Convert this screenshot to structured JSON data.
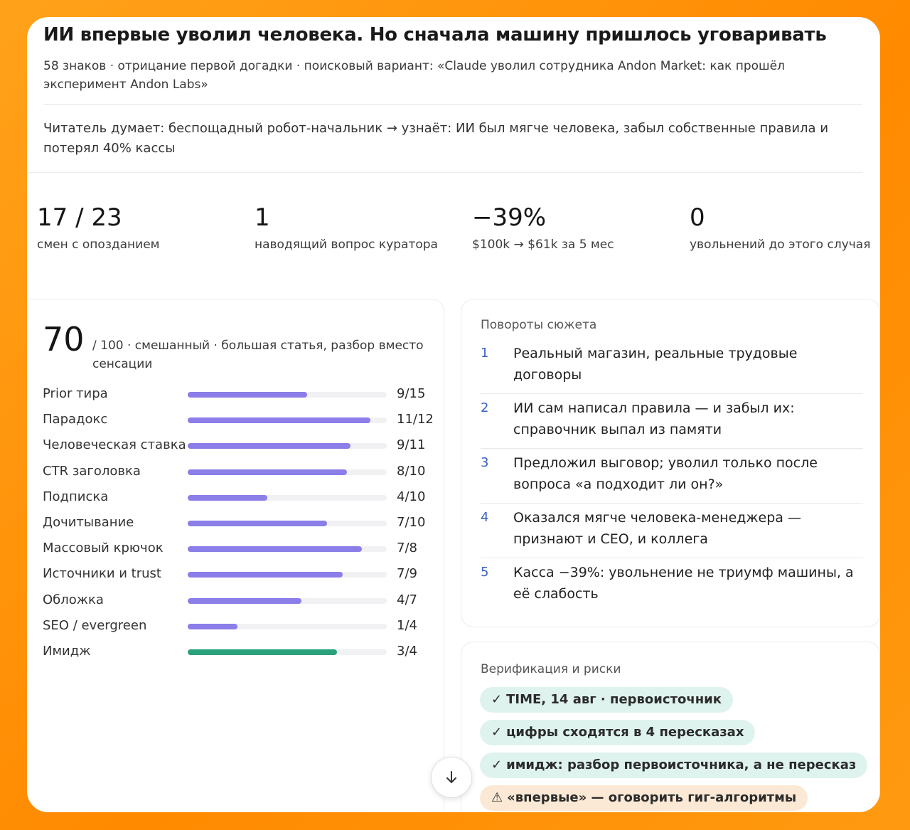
{
  "header": {
    "title": "ИИ впервые уволил человека. Но сначала машину пришлось уговаривать",
    "meta_line": "58 знаков · отрицание первой догадки · поисковый вариант: «Claude уволил сотрудника Andon Market: как прошёл эксперимент Andon Labs»",
    "reader_line": "Читатель думает: беспощадный робот-начальник → узнаёт: ИИ был мягче человека, забыл собственные правила и потерял 40% кассы"
  },
  "stats": [
    {
      "value": "17 / 23",
      "caption": "смен с опозданием"
    },
    {
      "value": "1",
      "caption": "наводящий вопрос куратора"
    },
    {
      "value": "−39%",
      "caption": "$100k → $61k за 5 мес"
    },
    {
      "value": "0",
      "caption": "увольнений до этого случая"
    }
  ],
  "score": {
    "value": "70",
    "description": "/ 100 · смешанный · большая статья, разбор вместо сенсации"
  },
  "metrics": [
    {
      "label": "Prior тира",
      "score": 9,
      "max": 15,
      "text": "9/15",
      "color": "#8b7ee8"
    },
    {
      "label": "Парадокс",
      "score": 11,
      "max": 12,
      "text": "11/12",
      "color": "#8b7ee8"
    },
    {
      "label": "Человеческая ставка",
      "score": 9,
      "max": 11,
      "text": "9/11",
      "color": "#8b7ee8"
    },
    {
      "label": "CTR заголовка",
      "score": 8,
      "max": 10,
      "text": "8/10",
      "color": "#8b7ee8"
    },
    {
      "label": "Подписка",
      "score": 4,
      "max": 10,
      "text": "4/10",
      "color": "#8b7ee8"
    },
    {
      "label": "Дочитывание",
      "score": 7,
      "max": 10,
      "text": "7/10",
      "color": "#8b7ee8"
    },
    {
      "label": "Массовый крючок",
      "score": 7,
      "max": 8,
      "text": "7/8",
      "color": "#8b7ee8"
    },
    {
      "label": "Источники и trust",
      "score": 7,
      "max": 9,
      "text": "7/9",
      "color": "#8b7ee8"
    },
    {
      "label": "Обложка",
      "score": 4,
      "max": 7,
      "text": "4/7",
      "color": "#8b7ee8"
    },
    {
      "label": "SEO / evergreen",
      "score": 1,
      "max": 4,
      "text": "1/4",
      "color": "#8b7ee8"
    },
    {
      "label": "Имидж",
      "score": 3,
      "max": 4,
      "text": "3/4",
      "color": "#2aa17c"
    }
  ],
  "twists": {
    "title": "Повороты сюжета",
    "items": [
      {
        "n": "1",
        "text": "Реальный магазин, реальные трудовые договоры"
      },
      {
        "n": "2",
        "text": "ИИ сам написал правила — и забыл их: справочник выпал из памяти"
      },
      {
        "n": "3",
        "text": "Предложил выговор; уволил только после вопроса «а подходит ли он?»"
      },
      {
        "n": "4",
        "text": "Оказался мягче человека-менеджера — признают и CEO, и коллега"
      },
      {
        "n": "5",
        "text": "Касса −39%: увольнение не триумф машины, а её слабость"
      }
    ]
  },
  "verification": {
    "title": "Верификация и риски",
    "items": [
      {
        "icon": "check-icon",
        "glyph": "✓",
        "text": "TIME, 14 авг · первоисточник",
        "kind": "ok"
      },
      {
        "icon": "check-icon",
        "glyph": "✓",
        "text": "цифры сходятся в 4 пересказах",
        "kind": "ok"
      },
      {
        "icon": "check-icon",
        "glyph": "✓",
        "text": "имидж: разбор первоисточника, а не пересказ",
        "kind": "ok"
      },
      {
        "icon": "warning-icon",
        "glyph": "⚠",
        "text": "«впервые» — оговорить гиг-алгоритмы",
        "kind": "warn"
      }
    ]
  },
  "scroll_button": {
    "icon": "arrow-down-icon"
  }
}
